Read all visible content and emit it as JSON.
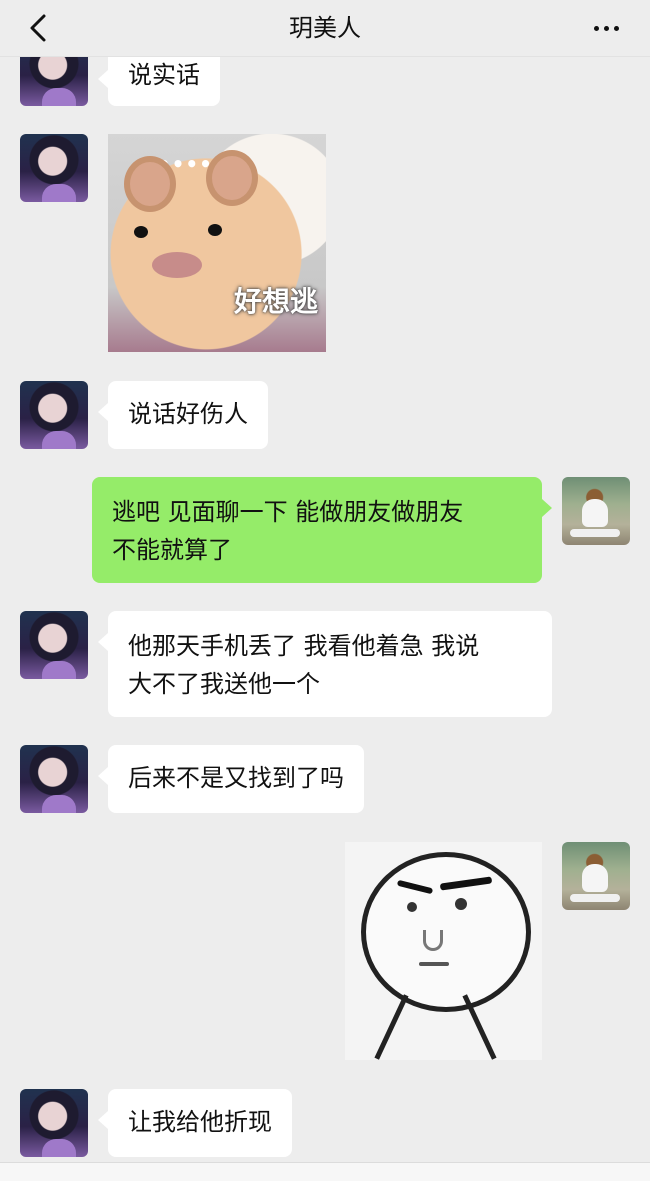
{
  "header": {
    "title": "玥美人"
  },
  "messages": [
    {
      "from": "them",
      "type": "text",
      "text": "说实话"
    },
    {
      "from": "them",
      "type": "sticker",
      "sticker": "hamster",
      "dots": "••••••",
      "caption": "好想逃"
    },
    {
      "from": "them",
      "type": "text",
      "text": "说话好伤人"
    },
    {
      "from": "me",
      "type": "text",
      "line1": "逃吧 见面聊一下 能做朋友做朋友",
      "line2": "不能就算了"
    },
    {
      "from": "them",
      "type": "text",
      "line1": "他那天手机丢了 我看他着急 我说",
      "line2": "大不了我送他一个"
    },
    {
      "from": "them",
      "type": "text",
      "text": "后来不是又找到了吗"
    },
    {
      "from": "me",
      "type": "sticker",
      "sticker": "meme-face"
    },
    {
      "from": "them",
      "type": "text",
      "text": "让我给他折现"
    }
  ],
  "colors": {
    "my_bubble": "#95ec69",
    "their_bubble": "#ffffff",
    "background": "#ededed"
  }
}
